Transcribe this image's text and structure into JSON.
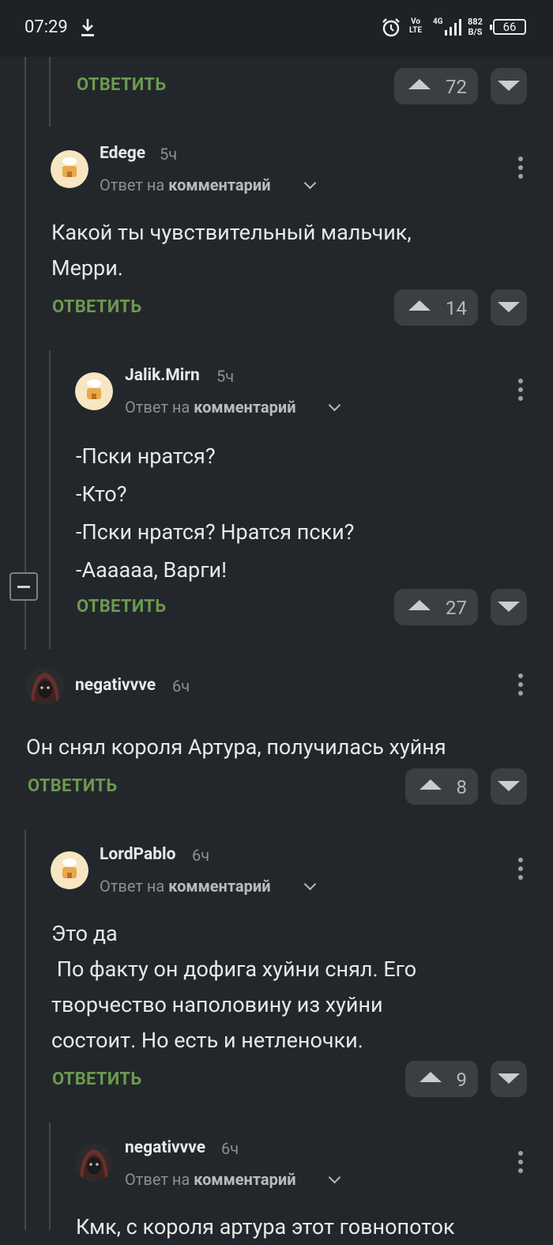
{
  "status_bar": {
    "time": "07:29",
    "volte_top": "Vo",
    "volte_bottom": "LTE",
    "network": "4G",
    "speed_top": "882",
    "speed_bottom": "B/S",
    "battery": "66"
  },
  "labels": {
    "reply": "ОТВЕТИТЬ",
    "reply_to_prefix": "Ответ на",
    "reply_to_link": "комментарий"
  },
  "top_comment": {
    "votes": "72"
  },
  "comments": [
    {
      "user": "Edege",
      "time": "5ч",
      "text": "Какой ты чувствительный мальчик,\nМерри.",
      "votes": "14"
    },
    {
      "user": "Jalik.Mirn",
      "time": "5ч",
      "text": "-Пски нратся?\n-Кто?\n-Пски нратся? Нратся пски?\n-Аааааа, Варги!",
      "votes": "27"
    },
    {
      "user": "negativvve",
      "time": "6ч",
      "text": "Он снял короля Артура, получилась хуйня",
      "votes": "8"
    },
    {
      "user": "LordPablo",
      "time": "6ч",
      "text": "Это да\n По факту он дофига хуйни снял. Его\nтворчество наполовину из хуйни\nсостоит. Но есть и нетленочки.",
      "votes": "9"
    },
    {
      "user": "negativvve",
      "time": "6ч",
      "text": "Кмк, с короля артура этот говнопоток"
    }
  ],
  "colors": {
    "background": "#23272b",
    "reply_green": "#6c9a4f",
    "vote_bg": "#3a3f44"
  }
}
